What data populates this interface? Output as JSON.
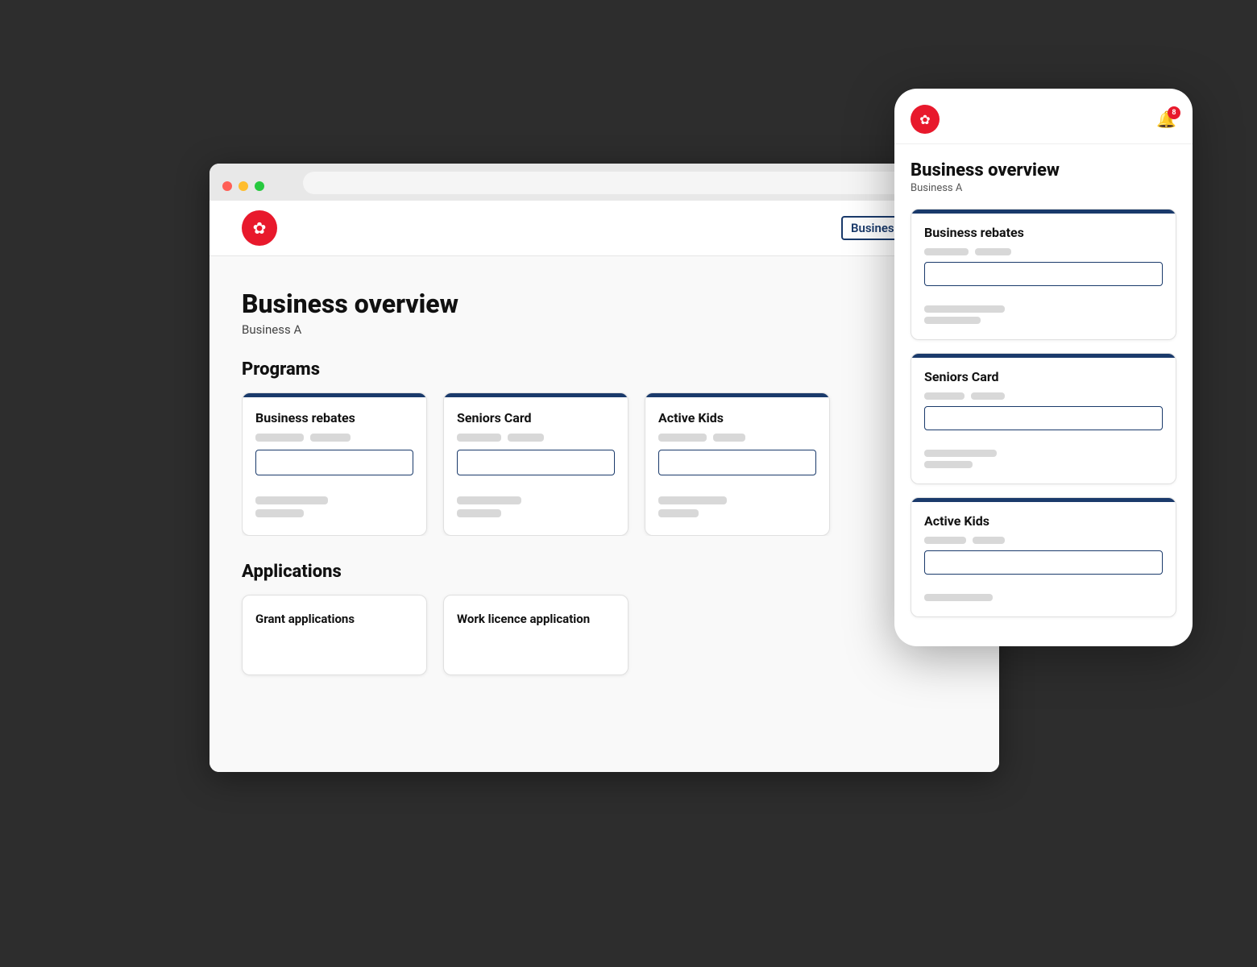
{
  "browser": {
    "dots": [
      "dot1",
      "dot2",
      "dot3"
    ]
  },
  "header": {
    "logo_label": "NSW Logo",
    "business_name": "Business A",
    "chevron": "▾",
    "notification_count": "8"
  },
  "desktop": {
    "page_title": "Business overview",
    "page_subtitle": "Business A",
    "programs_section_title": "Programs",
    "programs_cards": [
      {
        "title": "Business rebates"
      },
      {
        "title": "Seniors Card"
      },
      {
        "title": "Active Kids"
      }
    ],
    "applications_section_title": "Applications",
    "application_cards": [
      {
        "title": "Grant applications"
      },
      {
        "title": "Work licence application"
      }
    ]
  },
  "mobile": {
    "notification_count": "8",
    "page_title": "Business overview",
    "page_subtitle": "Business A",
    "program_cards": [
      {
        "title": "Business rebates"
      },
      {
        "title": "Seniors Card"
      },
      {
        "title": "Active Kids"
      }
    ]
  },
  "colors": {
    "accent_blue": "#1a3a6b",
    "accent_red": "#e8192c",
    "placeholder_gray": "#d8d8d8"
  }
}
